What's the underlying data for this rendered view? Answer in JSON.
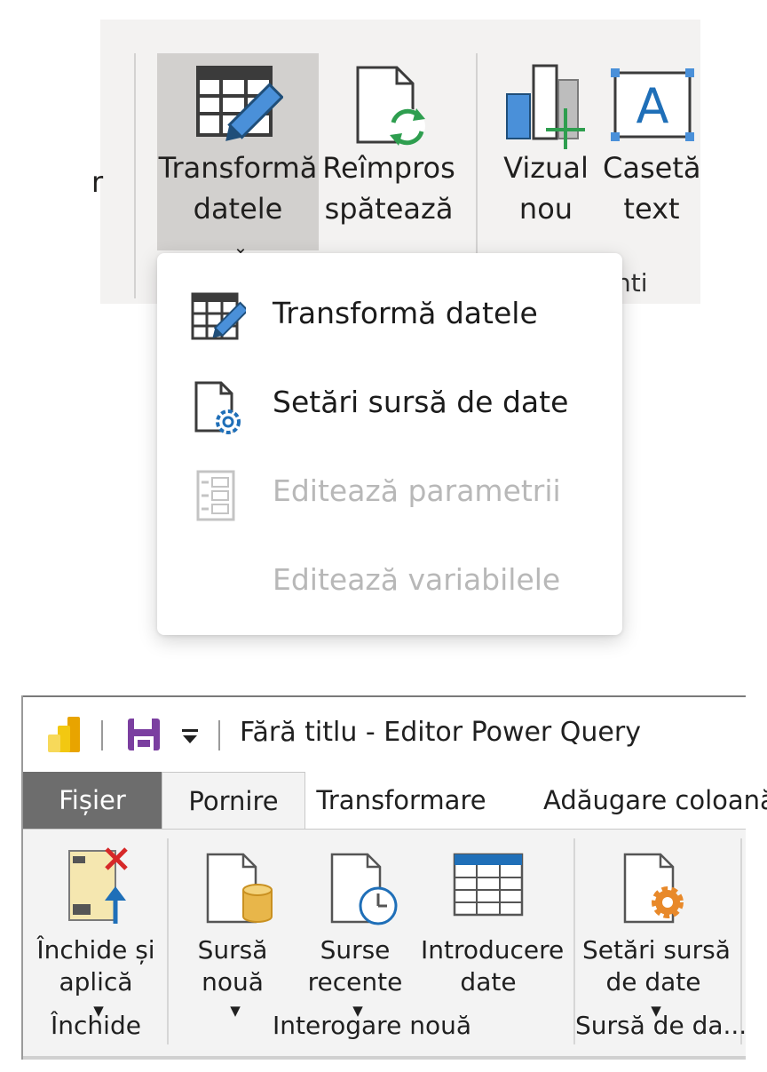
{
  "ribbon": {
    "cut_left_text": "r",
    "transform_button": {
      "line1": "Transformă",
      "line2": "datele",
      "chevron": "⌄",
      "icon": "table-pencil-icon"
    },
    "refresh_button": {
      "line1": "Reîmpros",
      "line2": "spătează",
      "icon": "document-refresh-icon"
    },
    "new_visual_button": {
      "line1": "Vizual",
      "line2": "nou",
      "icon": "bar-chart-plus-icon"
    },
    "textbox_button": {
      "line1": "Casetă",
      "line2": "text",
      "icon": "text-box-icon"
    },
    "group_label_fragment": "nti"
  },
  "dropdown": {
    "items": [
      {
        "label": "Transformă datele",
        "icon": "table-pencil-icon",
        "enabled": true
      },
      {
        "label": "Setări sursă de date",
        "icon": "document-gear-icon",
        "enabled": true
      },
      {
        "label": "Editează parametrii",
        "icon": "parameters-icon",
        "enabled": false
      },
      {
        "label": "Editează variabilele",
        "icon": "",
        "enabled": false
      }
    ]
  },
  "power_query": {
    "title": "Fără titlu - Editor Power Query",
    "titlebar_icons": [
      "power-bi-logo-icon",
      "save-icon",
      "quick-access-dropdown-icon"
    ],
    "tabs": [
      "Fișier",
      "Pornire",
      "Transformare",
      "Adăugare coloană"
    ],
    "active_tab": "Pornire",
    "buttons": {
      "close_apply": {
        "line1": "Închide și",
        "line2": "aplică",
        "icon": "close-apply-icon"
      },
      "new_source": {
        "line1": "Sursă",
        "line2": "nouă",
        "icon": "document-database-icon"
      },
      "recent_sources": {
        "line1": "Surse",
        "line2": "recente",
        "icon": "document-clock-icon"
      },
      "enter_data": {
        "line1": "Introducere",
        "line2": "date",
        "icon": "table-grid-icon"
      },
      "data_source_settings": {
        "line1": "Setări sursă",
        "line2": "de date",
        "icon": "document-gear-icon"
      }
    },
    "groups": {
      "close": "Închide",
      "new_query": "Interogare nouă",
      "data_source": "Sursă de da..."
    },
    "colors": {
      "file_tab": "#6d6d6d",
      "accent_blue": "#4a90d9",
      "accent_orange": "#e8892a",
      "save_purple": "#7b3fa0",
      "powerbi_yellow": "#f2c811"
    }
  }
}
